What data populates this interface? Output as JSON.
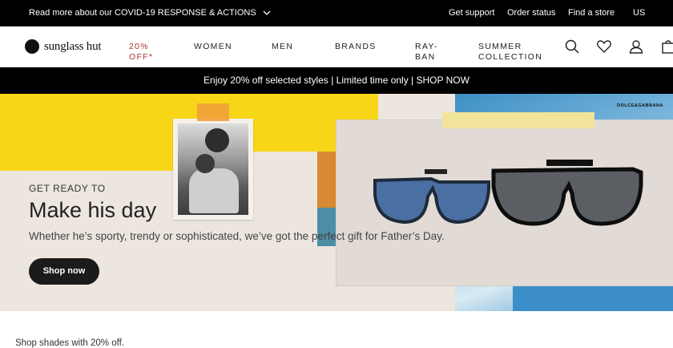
{
  "topbar": {
    "covid_link": "Read more about our COVID-19 RESPONSE & ACTIONS",
    "links": [
      "Get support",
      "Order status",
      "Find a store",
      "US"
    ]
  },
  "nav": {
    "logo": "sunglass hut",
    "sale_line1": "20%",
    "sale_line2": "OFF*",
    "items": [
      "WOMEN",
      "MEN",
      "BRANDS"
    ],
    "rayban_line1": "RAY-",
    "rayban_line2": "BAN",
    "summer_line1": "SUMMER",
    "summer_line2": "COLLECTION",
    "icons": [
      "search-icon",
      "heart-icon",
      "account-icon",
      "bag-icon"
    ]
  },
  "promo": {
    "text": "Enjoy 20% off selected styles | Limited time only | SHOP NOW"
  },
  "hero": {
    "brand_tag": "DOLCE&GABBANA",
    "eyebrow": "GET READY TO",
    "headline": "Make his day",
    "subtext": "Whether he’s sporty, trendy or sophisticated, we’ve got the perfect gift for Father’s Day.",
    "cta": "Shop now",
    "colors": {
      "yellow": "#f7d617",
      "blue": "#3c8ec8",
      "orange": "#d9892f"
    }
  },
  "below": {
    "text": "Shop shades with 20% off."
  }
}
